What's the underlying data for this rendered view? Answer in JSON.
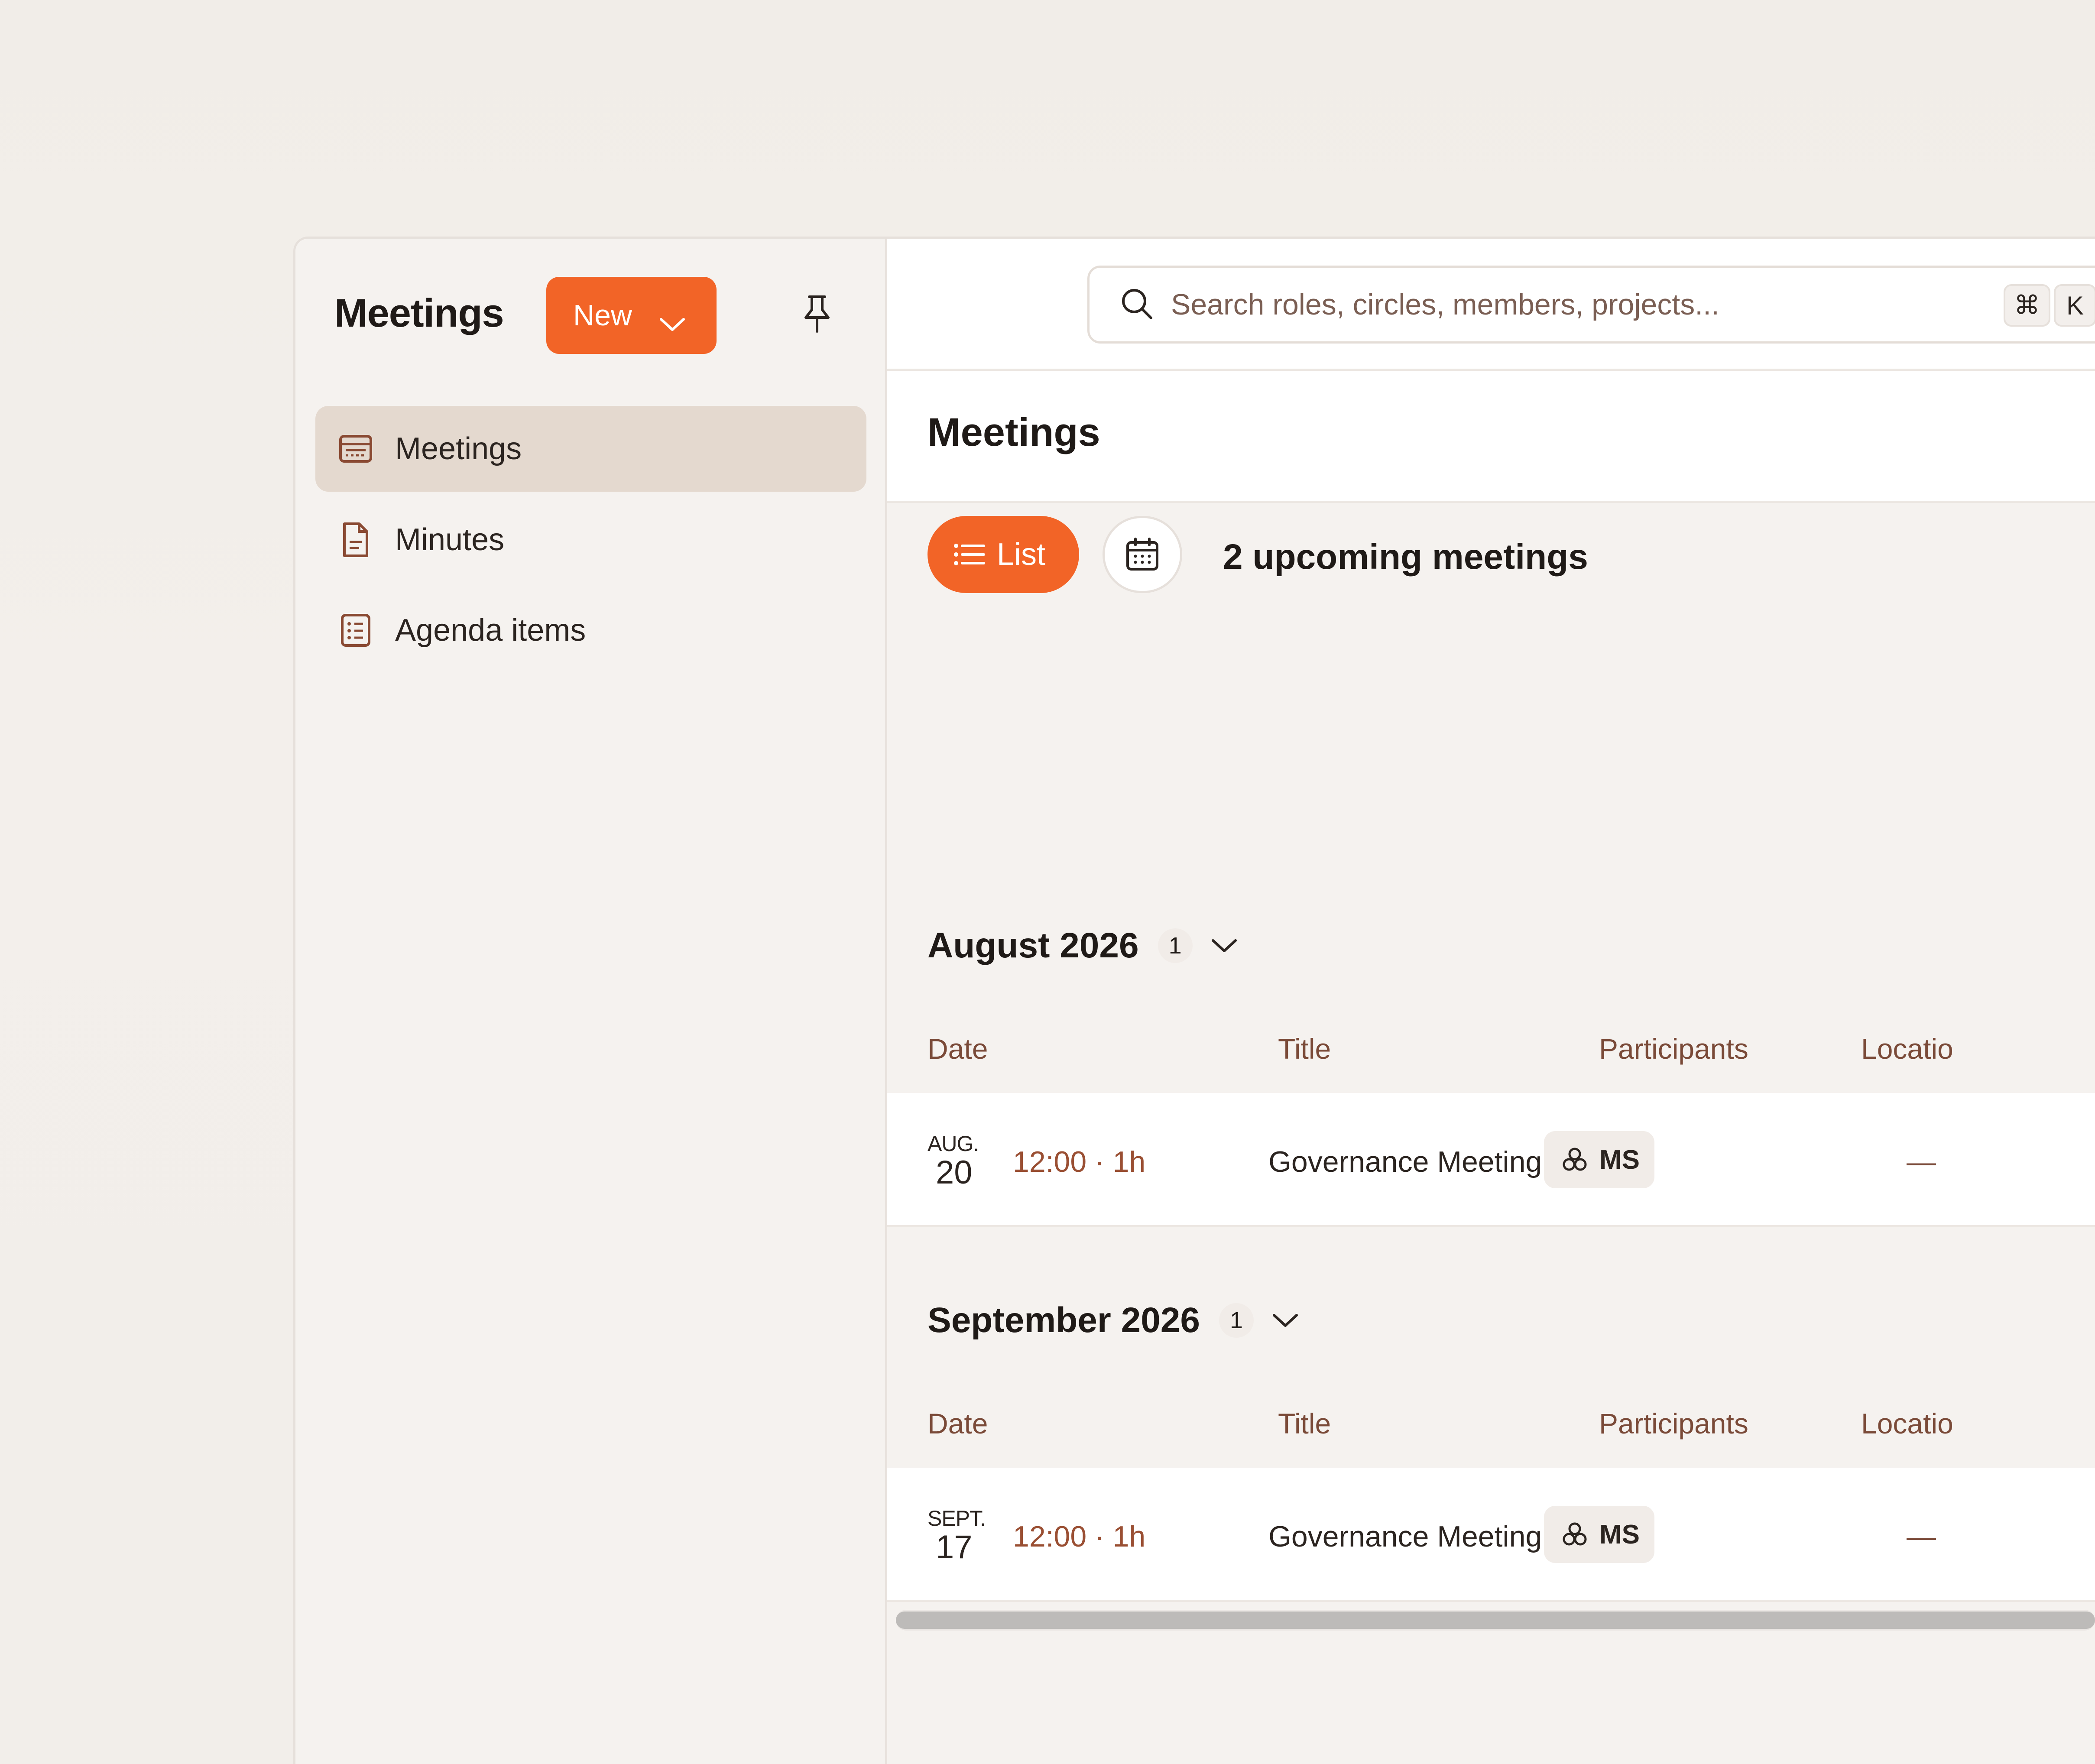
{
  "sidebar": {
    "title": "Meetings",
    "new_label": "New",
    "items": [
      {
        "label": "Meetings",
        "icon": "meetings-icon",
        "active": true
      },
      {
        "label": "Minutes",
        "icon": "document-icon",
        "active": false
      },
      {
        "label": "Agenda items",
        "icon": "list-icon",
        "active": false
      }
    ]
  },
  "search": {
    "placeholder": "Search roles, circles, members, projects...",
    "shortcut_cmd": "⌘",
    "shortcut_key": "K"
  },
  "main": {
    "title": "Meetings",
    "view_list_label": "List",
    "upcoming_count": "2 upcoming meetings",
    "columns": {
      "date": "Date",
      "title": "Title",
      "participants": "Participants",
      "location": "Locatio"
    },
    "groups": [
      {
        "label": "August 2026",
        "count": "1",
        "rows": [
          {
            "month": "AUG.",
            "day": "20",
            "time": "12:00 · 1h",
            "title": "Governance Meeting",
            "participant": "MS",
            "location": "—"
          }
        ]
      },
      {
        "label": "September 2026",
        "count": "1",
        "rows": [
          {
            "month": "SEPT.",
            "day": "17",
            "time": "12:00 · 1h",
            "title": "Governance Meeting",
            "participant": "MS",
            "location": "—"
          }
        ]
      }
    ]
  },
  "colors": {
    "accent": "#f26427",
    "muted_text": "#7a4a38",
    "active_nav": "#e4d9cf"
  }
}
